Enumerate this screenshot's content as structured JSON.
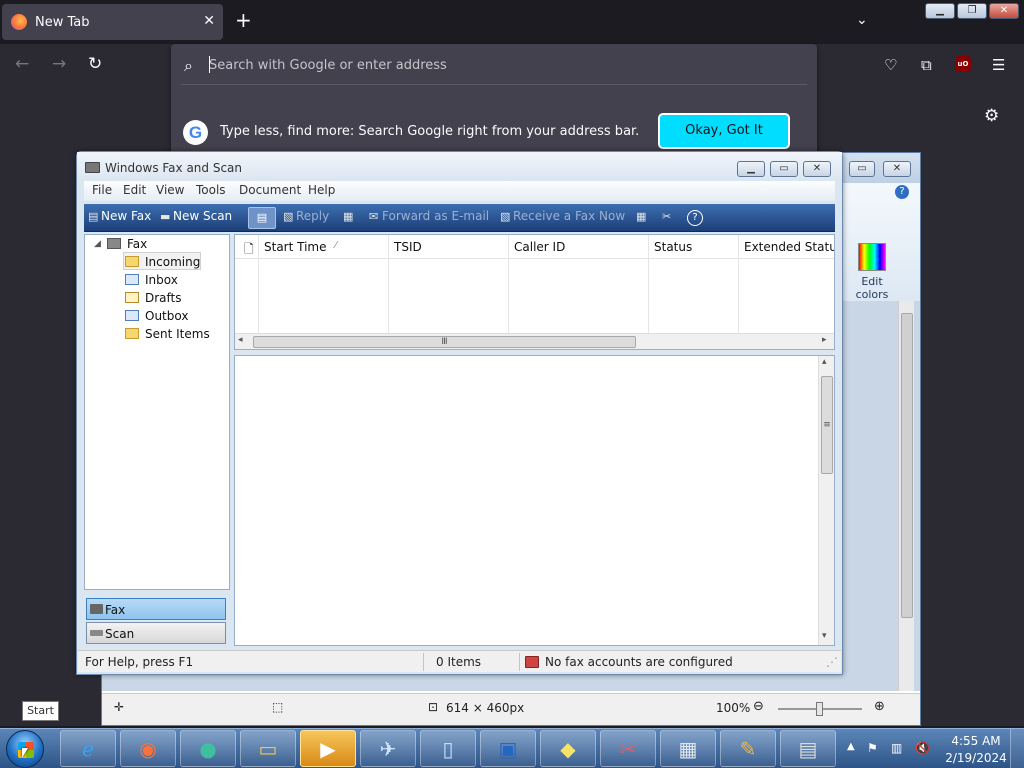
{
  "firefox": {
    "tab_title": "New Tab",
    "url_placeholder": "Search with Google or enter address",
    "suggestion_text": "Type less, find more: Search Google right from your address bar.",
    "ok_button": "Okay, Got It",
    "google_letter": "G",
    "extension_label": "uO",
    "accent_color": "#00ddff"
  },
  "paint": {
    "edit_colors_label": "Edit colors",
    "canvas_size": "614 × 460px",
    "zoom": "100%"
  },
  "fax": {
    "title": "Windows Fax and Scan",
    "menu": [
      "File",
      "Edit",
      "View",
      "Tools",
      "Document",
      "Help"
    ],
    "toolbar": {
      "new_fax": "New Fax",
      "new_scan": "New Scan",
      "reply": "Reply",
      "forward": "Forward as E-mail",
      "receive": "Receive a Fax Now"
    },
    "tree": {
      "root": "Fax",
      "folders": [
        "Incoming",
        "Inbox",
        "Drafts",
        "Outbox",
        "Sent Items"
      ],
      "selected": "Incoming"
    },
    "columns": [
      "Start Time",
      "TSID",
      "Caller ID",
      "Status",
      "Extended Status"
    ],
    "nav": {
      "fax": "Fax",
      "scan": "Scan"
    },
    "status": {
      "help": "For Help, press F1",
      "items": "0 Items",
      "accounts": "No fax accounts are configured"
    }
  },
  "taskbar": {
    "start_tooltip": "Start",
    "apps": [
      "start-orb",
      "internet-explorer",
      "firefox",
      "chat-app",
      "file-explorer",
      "media-player",
      "mail-app",
      "notepad",
      "remote-desktop",
      "sticky-notes",
      "snipping-tool",
      "calculator",
      "paint",
      "fax-and-scan"
    ],
    "time": "4:55 AM",
    "date": "2/19/2024"
  }
}
